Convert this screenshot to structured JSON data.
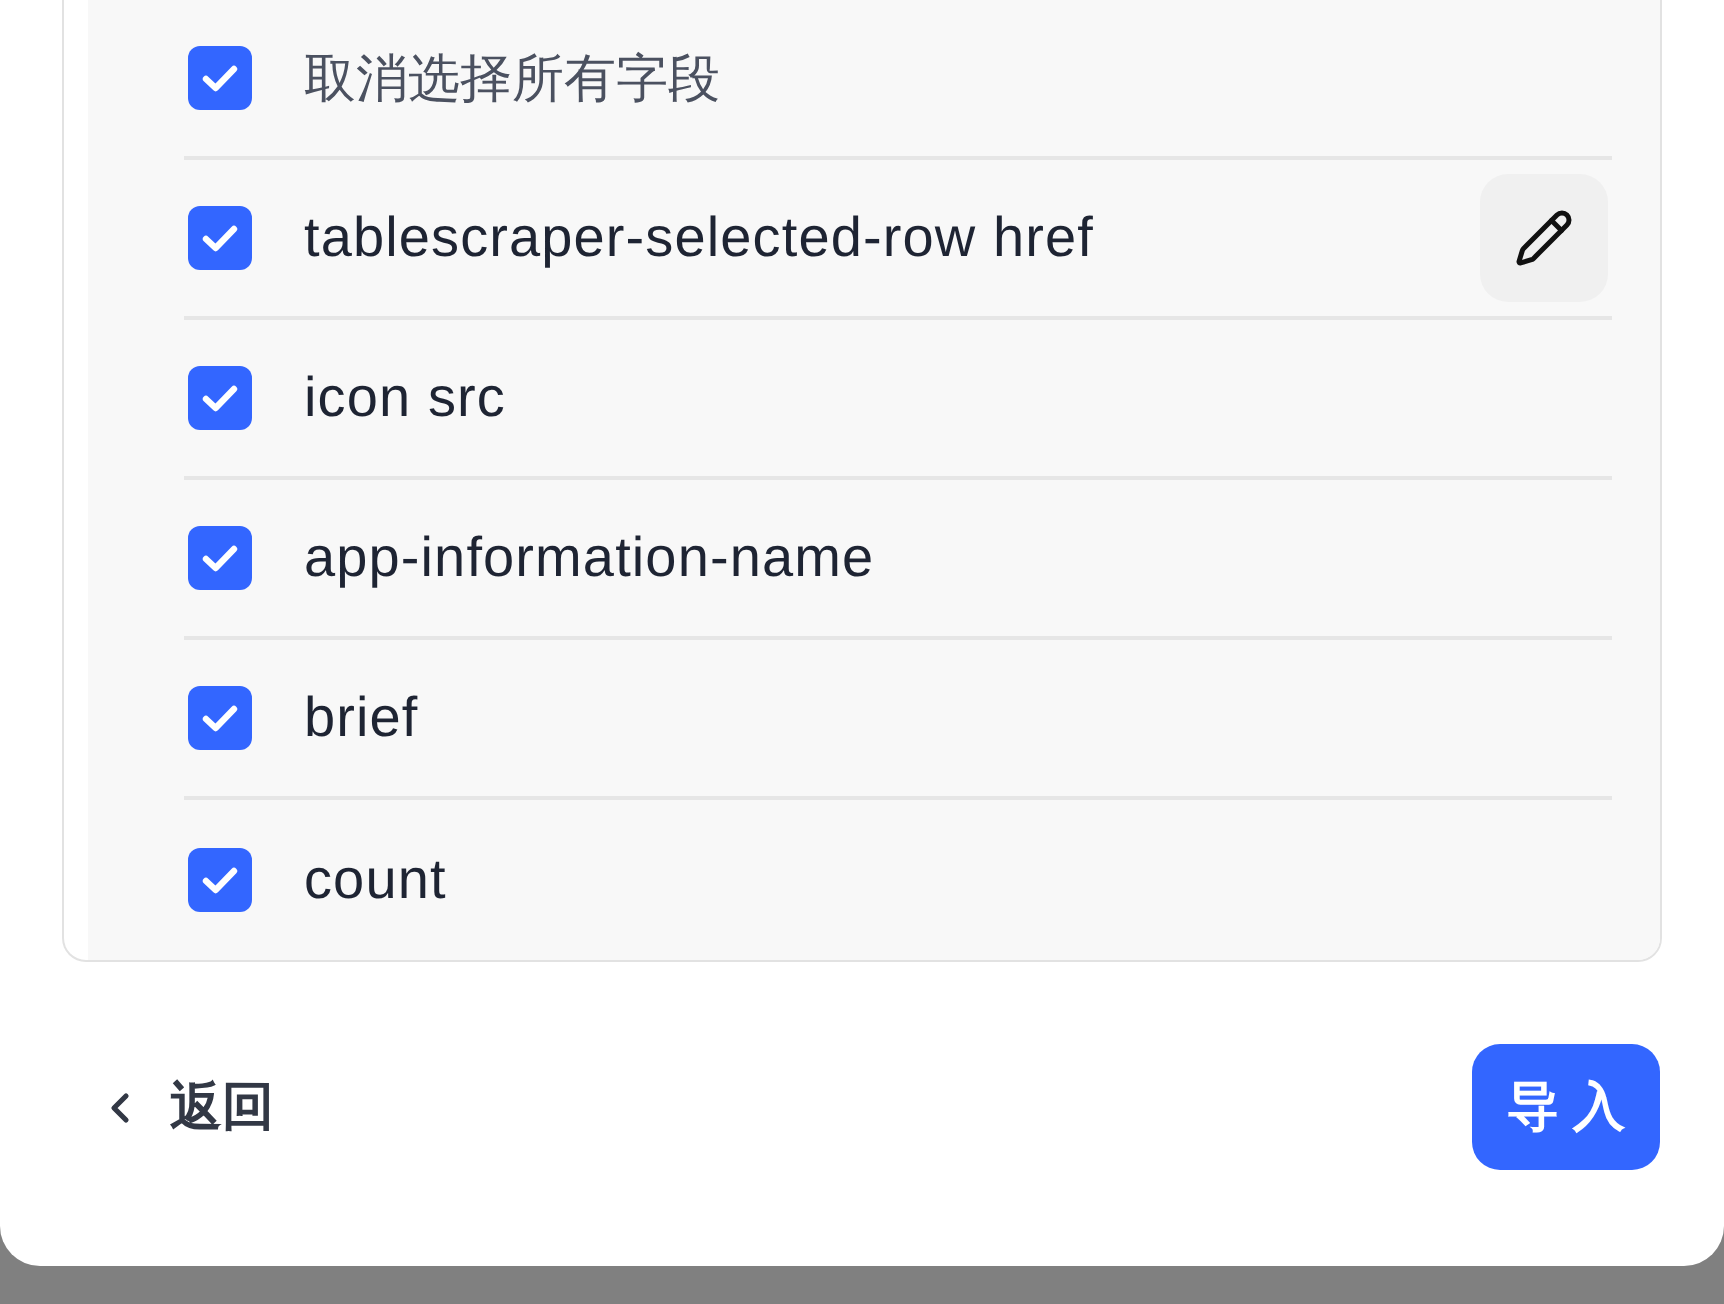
{
  "field_list": {
    "select_all": {
      "label": "取消选择所有字段",
      "checked": true
    },
    "fields": [
      {
        "name": "tablescraper-selected-row href",
        "checked": true,
        "hovered": true
      },
      {
        "name": "icon src",
        "checked": true,
        "hovered": false
      },
      {
        "name": "app-information-name",
        "checked": true,
        "hovered": false
      },
      {
        "name": "brief",
        "checked": true,
        "hovered": false
      },
      {
        "name": "count",
        "checked": true,
        "hovered": false
      }
    ]
  },
  "footer": {
    "back_button": "返回",
    "import_button": "导 入"
  }
}
